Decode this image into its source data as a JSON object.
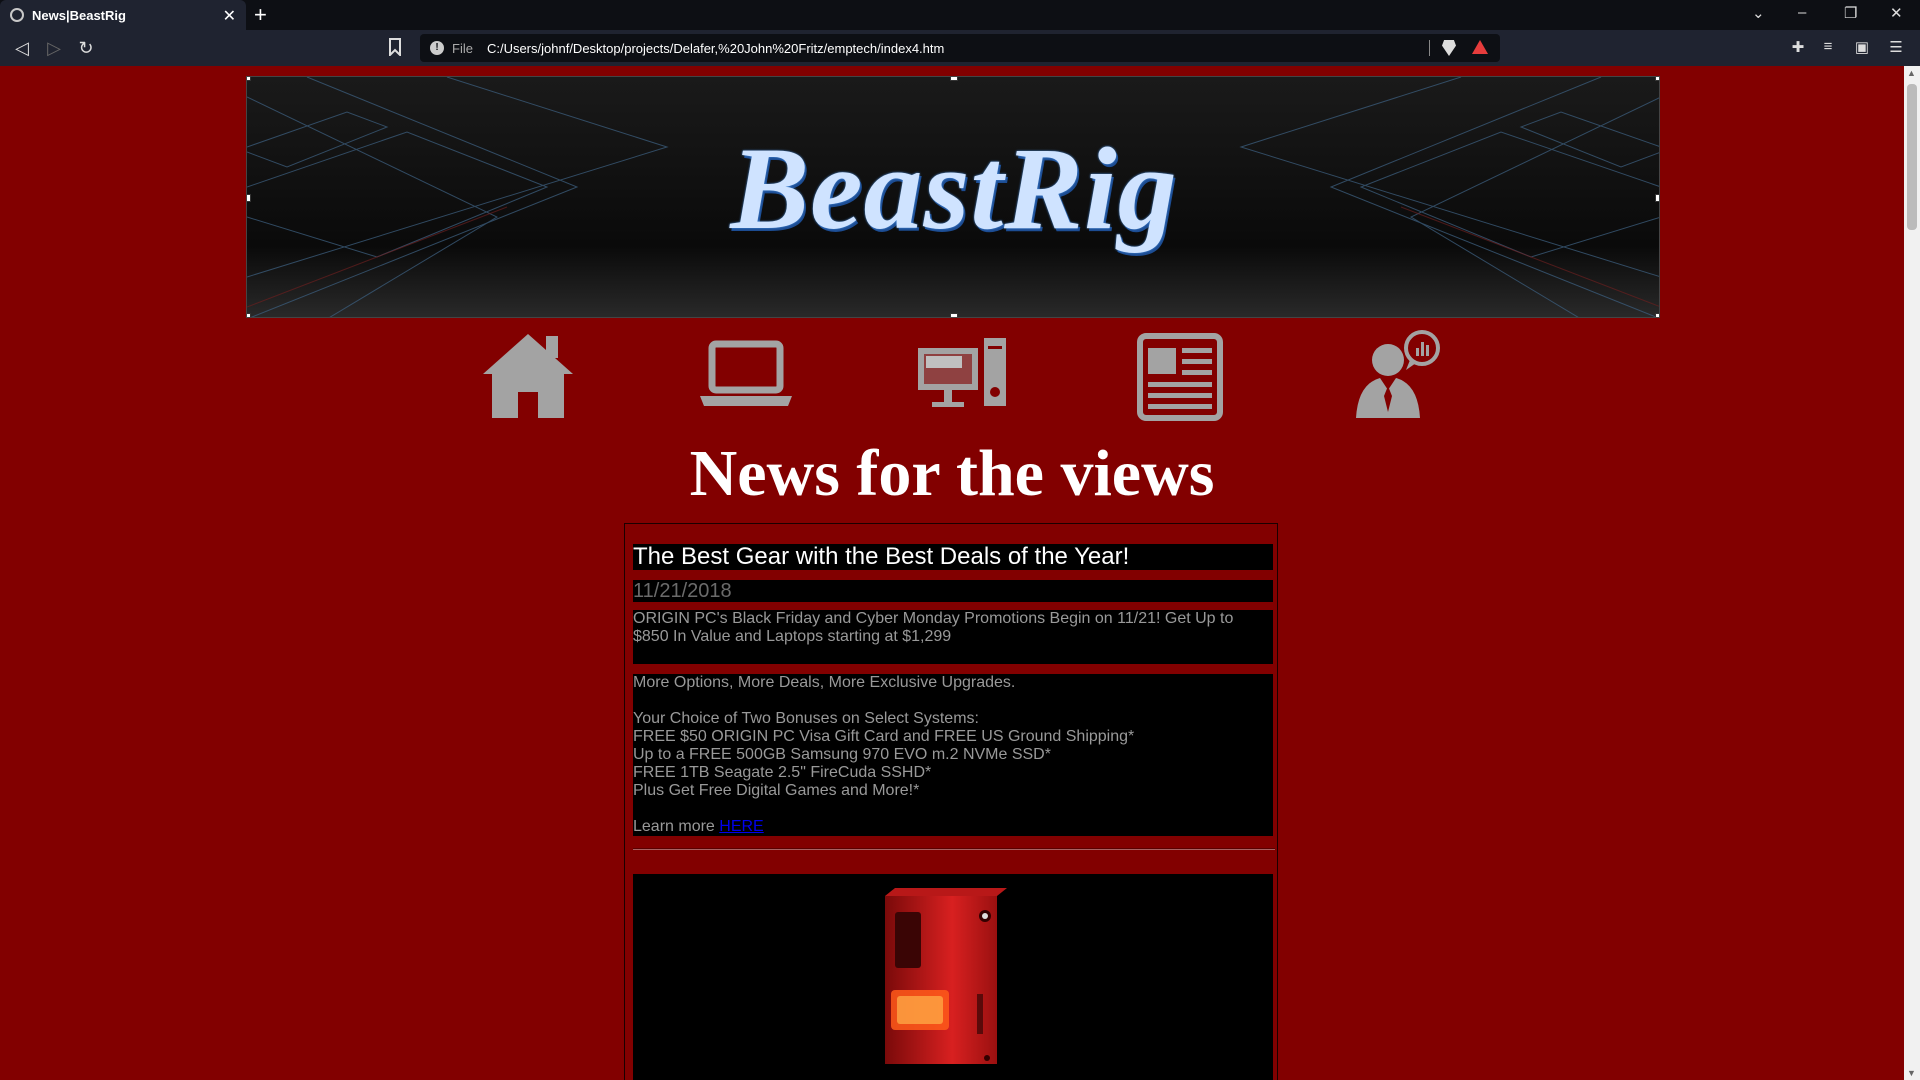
{
  "browser": {
    "tab_title": "News|BeastRig",
    "tab_close": "✕",
    "new_tab": "+",
    "address_scheme": "File",
    "address_url": "C:/Users/johnf/Desktop/projects/Delafer,%20John%20Fritz/emptech/index4.htm",
    "window_controls": [
      "⌄",
      "–",
      "❐",
      "✕"
    ]
  },
  "banner": {
    "logo": "BeastRig"
  },
  "nav_icons": [
    "home-icon",
    "laptop-icon",
    "desktop-pc-icon",
    "newspaper-icon",
    "support-person-icon"
  ],
  "page": {
    "headline": "News for the views"
  },
  "article": {
    "title": "The Best Gear with the Best Deals of the Year!",
    "date": "11/21/2018",
    "lead": "ORIGIN PC's Black Friday and Cyber Monday Promotions Begin on 11/21! Get Up to $850 In Value and Laptops starting at $1,299",
    "body_intro": "More Options, More Deals, More Exclusive Upgrades.",
    "bonus_heading": "Your Choice of Two Bonuses on Select Systems:",
    "bonuses": [
      "FREE $50 ORIGIN PC Visa Gift Card and FREE US Ground Shipping*",
      "Up to a FREE 500GB Samsung 970 EVO m.2 NVMe SSD*",
      "FREE 1TB Seagate 2.5\" FireCuda SSHD*",
      "Plus Get Free Digital Games and More!*"
    ],
    "learn_more": "Learn more ",
    "learn_more_link": "HERE"
  },
  "colors": {
    "page_bg": "#820000",
    "icon_gray": "#a3a3a3",
    "link": "#0000ee"
  }
}
